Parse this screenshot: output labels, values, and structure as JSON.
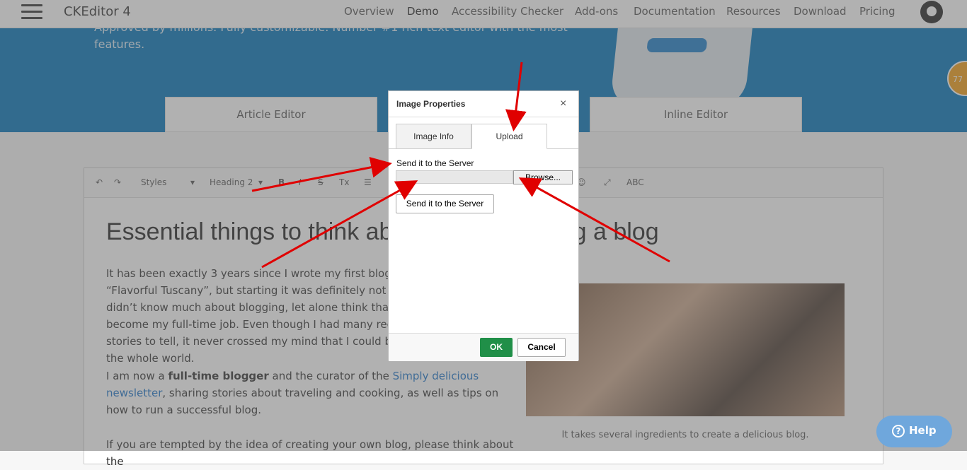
{
  "nav": {
    "brand": "CKEditor 4",
    "links": [
      "Overview",
      "Demo",
      "Accessibility Checker",
      "Add-ons",
      "Documentation",
      "Resources",
      "Download",
      "Pricing"
    ]
  },
  "hero": {
    "text": "Approved by millions. Fully customizable. Number #1 rich text editor with the most features.",
    "badge": "77"
  },
  "tabs": [
    "Article Editor",
    "Inline Editor"
  ],
  "toolbar": {
    "styles": "Styles",
    "format": "Heading 2"
  },
  "content": {
    "heading": "Essential things to think about before starting a blog",
    "p1": "It has been exactly 3 years since I wrote my first blog series entitled “Flavorful Tuscany”, but starting it was definitely not easy. Back then, I didn’t know much about blogging, let alone think that one day it could become my full-time job. Even though I had many recipes and food-related stories to tell, it never crossed my mind that I could be sharing them with the whole world.",
    "p2_pre": "I am now a ",
    "p2_bold": "full-time blogger",
    "p2_mid": " and the curator of the ",
    "p2_link": "Simply delicious newsletter",
    "p2_post": ", sharing stories about traveling and cooking, as well as tips on how to run a successful blog.",
    "p3": "If you are tempted by the idea of creating your own blog, please think about the",
    "caption": "It takes several ingredients to create a delicious blog."
  },
  "dialog": {
    "title": "Image Properties",
    "close": "×",
    "tab_info": "Image Info",
    "tab_upload": "Upload",
    "label": "Send it to the Server",
    "browse": "Browse...",
    "send": "Send it to the Server",
    "ok": "OK",
    "cancel": "Cancel"
  },
  "help": {
    "label": "Help",
    "icon": "?"
  },
  "colors": {
    "accent": "#0073b8",
    "ok": "#208f48",
    "arrow": "#e00000"
  }
}
